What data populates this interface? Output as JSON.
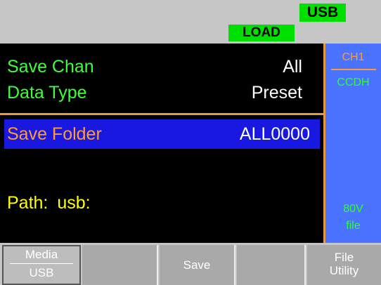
{
  "status": {
    "usb": "USB",
    "load": "LOAD"
  },
  "main": {
    "save_chan_label": "Save Chan",
    "save_chan_value": "All",
    "data_type_label": "Data Type",
    "data_type_value": "Preset",
    "save_folder_label": "Save Folder",
    "save_folder_value": "ALL0000",
    "path_label": "Path:",
    "path_value": "usb:"
  },
  "side": {
    "channel": "CH1",
    "mode": "CCDH",
    "range": "80V",
    "type": "file"
  },
  "softkeys": {
    "media_label": "Media",
    "media_value": "USB",
    "save_label": "Save",
    "file_utility_line1": "File",
    "file_utility_line2": "Utility"
  },
  "colors": {
    "green_label": "#3cff3c",
    "orange_label": "#ff9a3c",
    "selection_blue": "#1818e0",
    "side_panel_blue": "#4a74ff",
    "path_yellow": "#ffff00",
    "status_green": "#00e000"
  }
}
